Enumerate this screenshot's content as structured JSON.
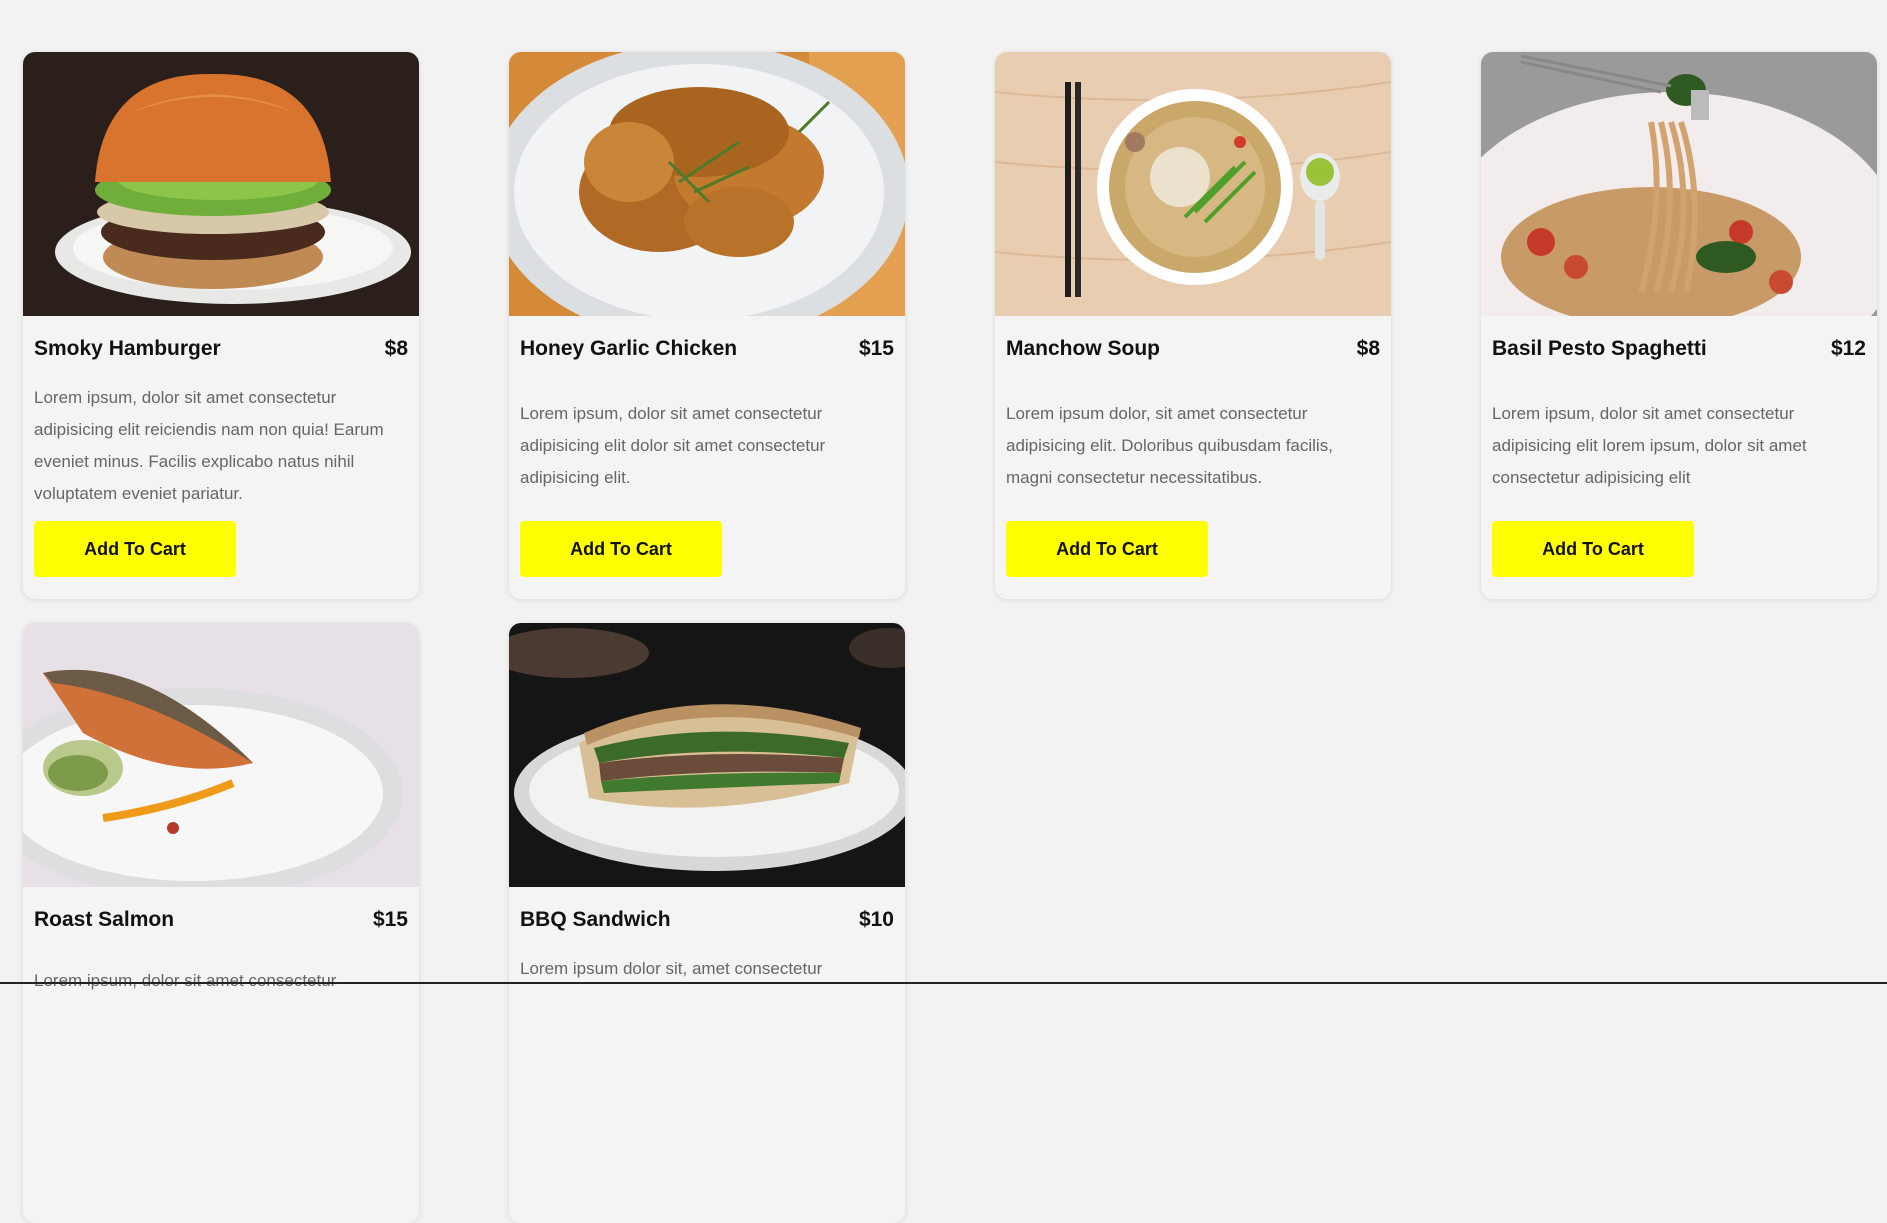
{
  "menu": {
    "items": [
      {
        "name": "Smoky Hamburger",
        "price": "$8",
        "description": "Lorem ipsum, dolor sit amet consectetur adipisicing elit reiciendis nam non quia! Earum eveniet minus. Facilis explicabo natus nihil voluptatem eveniet pariatur.",
        "button": "Add To Cart",
        "image": "hamburger-photo"
      },
      {
        "name": "Honey Garlic Chicken",
        "price": "$15",
        "description": "Lorem ipsum, dolor sit amet consectetur adipisicing elit dolor sit amet consectetur adipisicing elit.",
        "button": "Add To Cart",
        "image": "chicken-photo"
      },
      {
        "name": "Manchow Soup",
        "price": "$8",
        "description": "Lorem ipsum dolor, sit amet consectetur adipisicing elit. Doloribus quibusdam facilis, magni consectetur necessitatibus.",
        "button": "Add To Cart",
        "image": "soup-photo"
      },
      {
        "name": "Basil Pesto Spaghetti",
        "price": "$12",
        "description": "Lorem ipsum, dolor sit amet consectetur adipisicing elit lorem ipsum, dolor sit amet consectetur adipisicing elit",
        "button": "Add To Cart",
        "image": "spaghetti-photo"
      },
      {
        "name": "Roast Salmon",
        "price": "$15",
        "description": "Lorem ipsum, dolor sit amet consectetur",
        "image": "salmon-photo"
      },
      {
        "name": "BBQ Sandwich",
        "price": "$10",
        "description": "Lorem ipsum dolor sit, amet consectetur",
        "image": "sandwich-photo"
      }
    ]
  },
  "colors": {
    "page_background": "#f2f2f2",
    "button_background": "#ffff00"
  }
}
